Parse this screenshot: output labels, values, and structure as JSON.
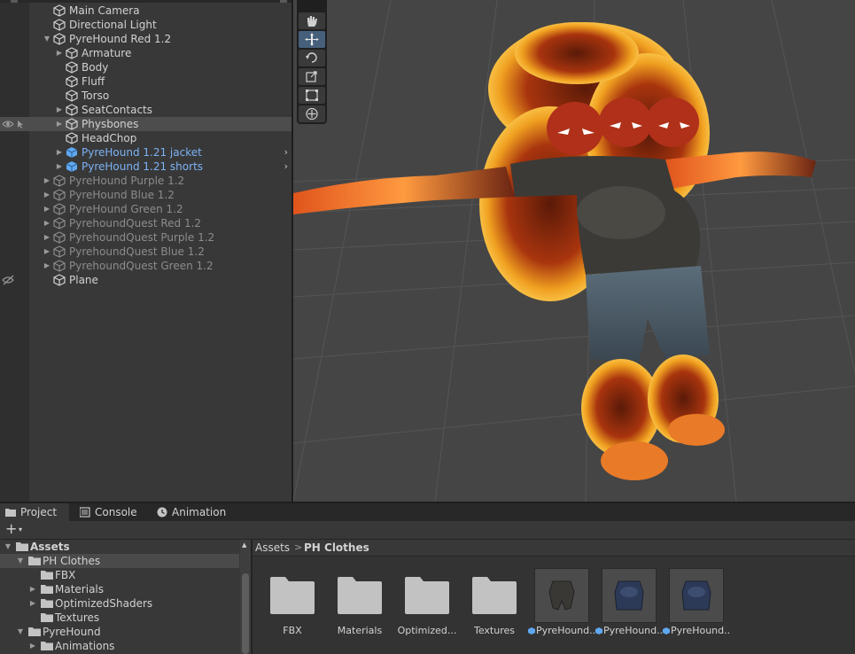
{
  "hierarchy": {
    "rows": [
      {
        "label": "Main Camera",
        "indent": 0,
        "arrow": "",
        "style": "normal"
      },
      {
        "label": "Directional Light",
        "indent": 0,
        "arrow": "",
        "style": "normal"
      },
      {
        "label": "PyreHound Red 1.2",
        "indent": 0,
        "arrow": "down",
        "style": "normal"
      },
      {
        "label": "Armature",
        "indent": 1,
        "arrow": "right",
        "style": "normal"
      },
      {
        "label": "Body",
        "indent": 1,
        "arrow": "",
        "style": "normal"
      },
      {
        "label": "Fluff",
        "indent": 1,
        "arrow": "",
        "style": "normal"
      },
      {
        "label": "Torso",
        "indent": 1,
        "arrow": "",
        "style": "normal"
      },
      {
        "label": "SeatContacts",
        "indent": 1,
        "arrow": "right",
        "style": "normal"
      },
      {
        "label": "Physbones",
        "indent": 1,
        "arrow": "right",
        "style": "normal"
      },
      {
        "label": "HeadChop",
        "indent": 1,
        "arrow": "",
        "style": "normal"
      },
      {
        "label": "PyreHound 1.21 jacket",
        "indent": 1,
        "arrow": "right",
        "style": "prefab"
      },
      {
        "label": "PyreHound 1.21 shorts",
        "indent": 1,
        "arrow": "right",
        "style": "prefab"
      },
      {
        "label": "PyreHound Purple 1.2",
        "indent": 0,
        "arrow": "right",
        "style": "dim"
      },
      {
        "label": "PyreHound Blue 1.2",
        "indent": 0,
        "arrow": "right",
        "style": "dim"
      },
      {
        "label": "PyreHound Green 1.2",
        "indent": 0,
        "arrow": "right",
        "style": "dim"
      },
      {
        "label": "PyrehoundQuest Red 1.2",
        "indent": 0,
        "arrow": "right",
        "style": "dim"
      },
      {
        "label": "PyrehoundQuest Purple 1.2",
        "indent": 0,
        "arrow": "right",
        "style": "dim"
      },
      {
        "label": "PyrehoundQuest Blue 1.2",
        "indent": 0,
        "arrow": "right",
        "style": "dim"
      },
      {
        "label": "PyrehoundQuest Green 1.2",
        "indent": 0,
        "arrow": "right",
        "style": "dim"
      },
      {
        "label": "Plane",
        "indent": 0,
        "arrow": "",
        "style": "normal"
      }
    ]
  },
  "tabs": {
    "project": "Project",
    "console": "Console",
    "animation": "Animation"
  },
  "toolbar": {
    "plus": "+",
    "dropdown": "▾"
  },
  "tree": {
    "rows": [
      {
        "label": "Assets",
        "indent": 0,
        "arrow": "down",
        "bold": true
      },
      {
        "label": "PH Clothes",
        "indent": 1,
        "arrow": "down",
        "bold": false
      },
      {
        "label": "FBX",
        "indent": 2,
        "arrow": "",
        "bold": false
      },
      {
        "label": "Materials",
        "indent": 2,
        "arrow": "right",
        "bold": false
      },
      {
        "label": "OptimizedShaders",
        "indent": 2,
        "arrow": "right",
        "bold": false
      },
      {
        "label": "Textures",
        "indent": 2,
        "arrow": "",
        "bold": false
      },
      {
        "label": "PyreHound",
        "indent": 1,
        "arrow": "down",
        "bold": false
      },
      {
        "label": "Animations",
        "indent": 2,
        "arrow": "right",
        "bold": false
      }
    ]
  },
  "breadcrumb": {
    "root": "Assets",
    "separator": ">",
    "current": "PH Clothes"
  },
  "assets": {
    "items": [
      {
        "name": "FBX",
        "kind": "folder"
      },
      {
        "name": "Materials",
        "kind": "folder"
      },
      {
        "name": "Optimized...",
        "kind": "folder"
      },
      {
        "name": "Textures",
        "kind": "folder"
      },
      {
        "name": "PyreHound...",
        "kind": "prefab"
      },
      {
        "name": "PyreHound...",
        "kind": "prefab"
      },
      {
        "name": "PyreHound...",
        "kind": "prefab"
      }
    ]
  },
  "colors": {
    "prefab_text": "#7cb3f5",
    "active_tool": "#46607c",
    "scene_bg": "#454545"
  }
}
